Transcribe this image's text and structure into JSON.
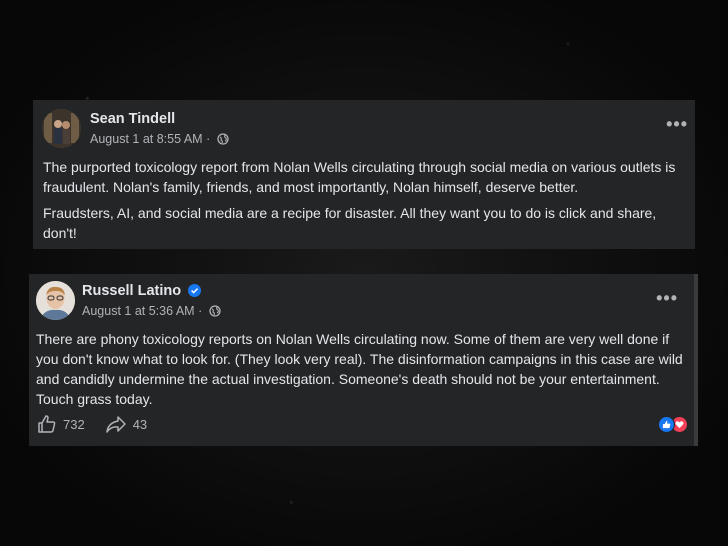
{
  "posts": [
    {
      "author": "Sean Tindell",
      "timestamp": "August 1 at 8:55 AM",
      "separator": "·",
      "privacy_icon": "globe-icon",
      "paragraphs": [
        "The purported toxicology report from Nolan Wells circulating through social media on various outlets is fraudulent. Nolan's family, friends, and most importantly, Nolan himself, deserve better.",
        "Fraudsters, AI, and social media are a recipe for disaster.  All they want you to do is click and share, don't!"
      ],
      "more_label": "•••"
    },
    {
      "author": "Russell Latino",
      "verified": true,
      "timestamp": "August 1 at 5:36 AM",
      "separator": "·",
      "privacy_icon": "globe-icon",
      "text": "There are phony toxicology reports on Nolan Wells circulating now. Some of them are very well done if you don't know what to look for. (They look very real). The disinformation campaigns in this case are wild and candidly undermine the actual investigation. Someone's death should not be your entertainment. Touch grass today.",
      "more_label": "•••",
      "likes": "732",
      "shares": "43",
      "reactions": [
        "like-icon",
        "love-icon"
      ]
    }
  ],
  "colors": {
    "card_bg": "#242526",
    "text_primary": "#e4e6eb",
    "text_secondary": "#b0b3b8",
    "verified_blue": "#1877f2",
    "love_red": "#f33e58"
  }
}
